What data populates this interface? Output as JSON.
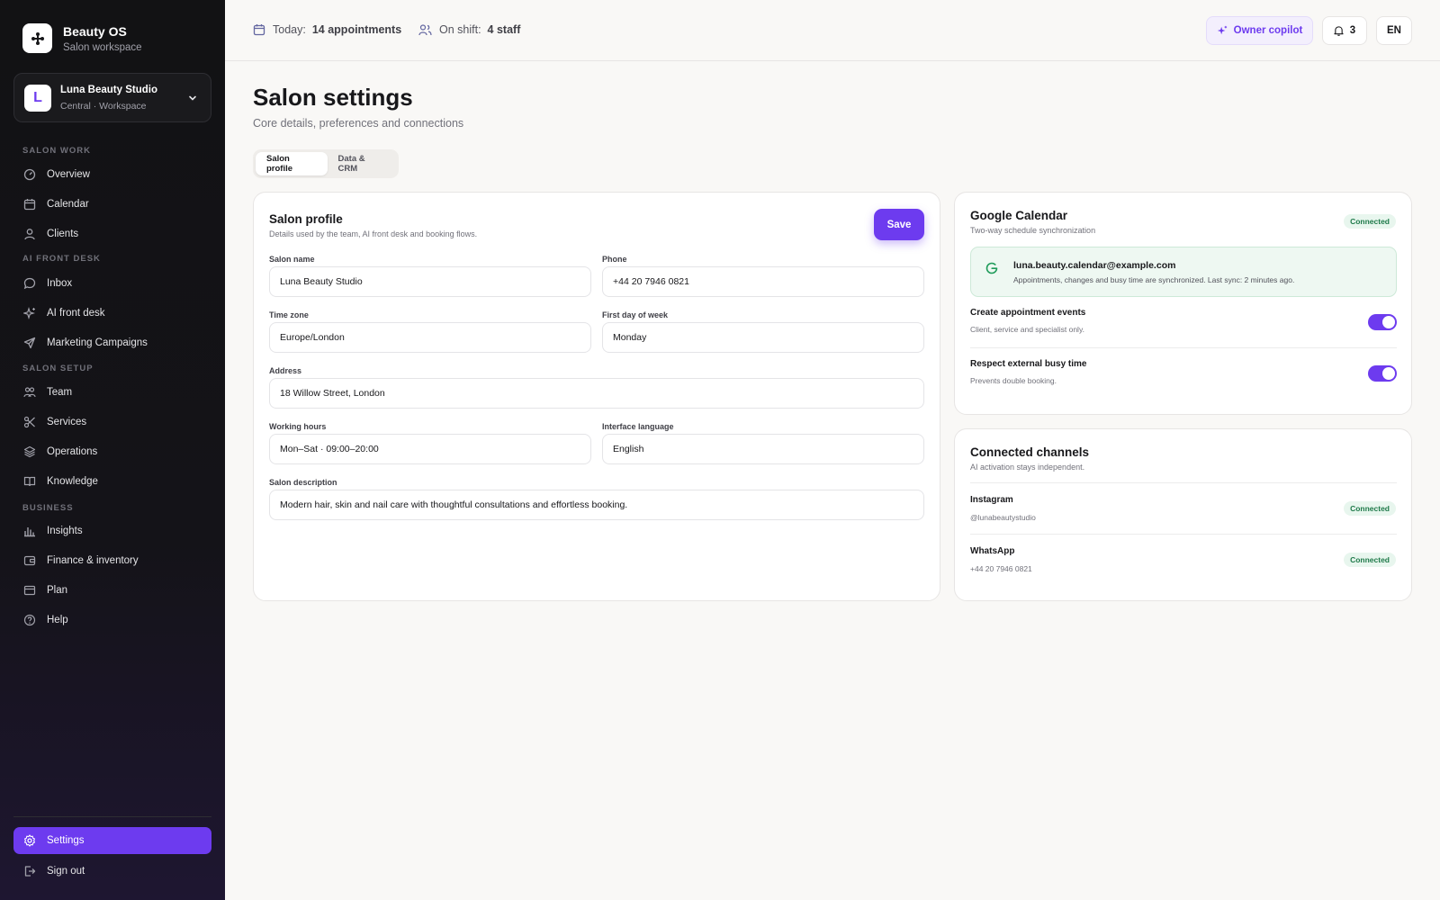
{
  "brand": {
    "name": "Beauty OS",
    "subtitle": "Salon workspace"
  },
  "workspace": {
    "initial": "L",
    "name": "Luna Beauty Studio",
    "subtitle": "Central · Workspace"
  },
  "nav": {
    "sections": [
      {
        "title": "SALON WORK",
        "items": [
          {
            "label": "Overview",
            "icon": "gauge-icon"
          },
          {
            "label": "Calendar",
            "icon": "calendar-icon"
          },
          {
            "label": "Clients",
            "icon": "user-icon"
          }
        ]
      },
      {
        "title": "AI FRONT DESK",
        "items": [
          {
            "label": "Inbox",
            "icon": "chat-icon"
          },
          {
            "label": "AI front desk",
            "icon": "sparkle-icon"
          },
          {
            "label": "Marketing Campaigns",
            "icon": "send-icon"
          }
        ]
      },
      {
        "title": "SALON SETUP",
        "items": [
          {
            "label": "Team",
            "icon": "team-icon"
          },
          {
            "label": "Services",
            "icon": "scissors-icon"
          },
          {
            "label": "Operations",
            "icon": "layers-icon"
          },
          {
            "label": "Knowledge",
            "icon": "book-icon"
          }
        ]
      },
      {
        "title": "BUSINESS",
        "items": [
          {
            "label": "Insights",
            "icon": "bar-chart-icon"
          },
          {
            "label": "Finance & inventory",
            "icon": "wallet-icon"
          },
          {
            "label": "Plan",
            "icon": "card-icon"
          },
          {
            "label": "Help",
            "icon": "help-icon"
          }
        ]
      }
    ],
    "settings": "Settings",
    "signout": "Sign out"
  },
  "topbar": {
    "today_label": "Today:",
    "today_value": "14 appointments",
    "shift_label": "On shift:",
    "shift_value": "4 staff",
    "copilot": "Owner copilot",
    "notifications": "3",
    "language": "EN"
  },
  "page": {
    "title": "Salon settings",
    "subtitle": "Core details, preferences and connections",
    "tabs": [
      "Salon profile",
      "Data & CRM"
    ]
  },
  "profile": {
    "title": "Salon profile",
    "subtitle": "Details used by the team, AI front desk and booking flows.",
    "save": "Save",
    "fields": {
      "salon_name": {
        "label": "Salon name",
        "value": "Luna Beauty Studio"
      },
      "phone": {
        "label": "Phone",
        "value": "+44 20 7946 0821"
      },
      "time_zone": {
        "label": "Time zone",
        "value": "Europe/London"
      },
      "first_day": {
        "label": "First day of week",
        "value": "Monday"
      },
      "address": {
        "label": "Address",
        "value": "18 Willow Street, London"
      },
      "hours": {
        "label": "Working hours",
        "value": "Mon–Sat · 09:00–20:00"
      },
      "language": {
        "label": "Interface language",
        "value": "English"
      },
      "description": {
        "label": "Salon description",
        "value": "Modern hair, skin and nail care with thoughtful consultations and effortless booking."
      }
    }
  },
  "gcal": {
    "title": "Google Calendar",
    "subtitle": "Two-way schedule synchronization",
    "status": "Connected",
    "email": "luna.beauty.calendar@example.com",
    "sync_desc": "Appointments, changes and busy time are synchronized. Last sync: 2 minutes ago.",
    "options": [
      {
        "title": "Create appointment events",
        "desc": "Client, service and specialist only.",
        "enabled": true
      },
      {
        "title": "Respect external busy time",
        "desc": "Prevents double booking.",
        "enabled": true
      }
    ]
  },
  "channels": {
    "title": "Connected channels",
    "subtitle": "AI activation stays independent.",
    "items": [
      {
        "name": "Instagram",
        "handle": "@lunabeautystudio",
        "status": "Connected"
      },
      {
        "name": "WhatsApp",
        "handle": "+44 20 7946 0821",
        "status": "Connected"
      }
    ]
  },
  "colors": {
    "accent": "#6d3bef",
    "sidebar": "#121214",
    "connected": "#1f7a4a"
  }
}
